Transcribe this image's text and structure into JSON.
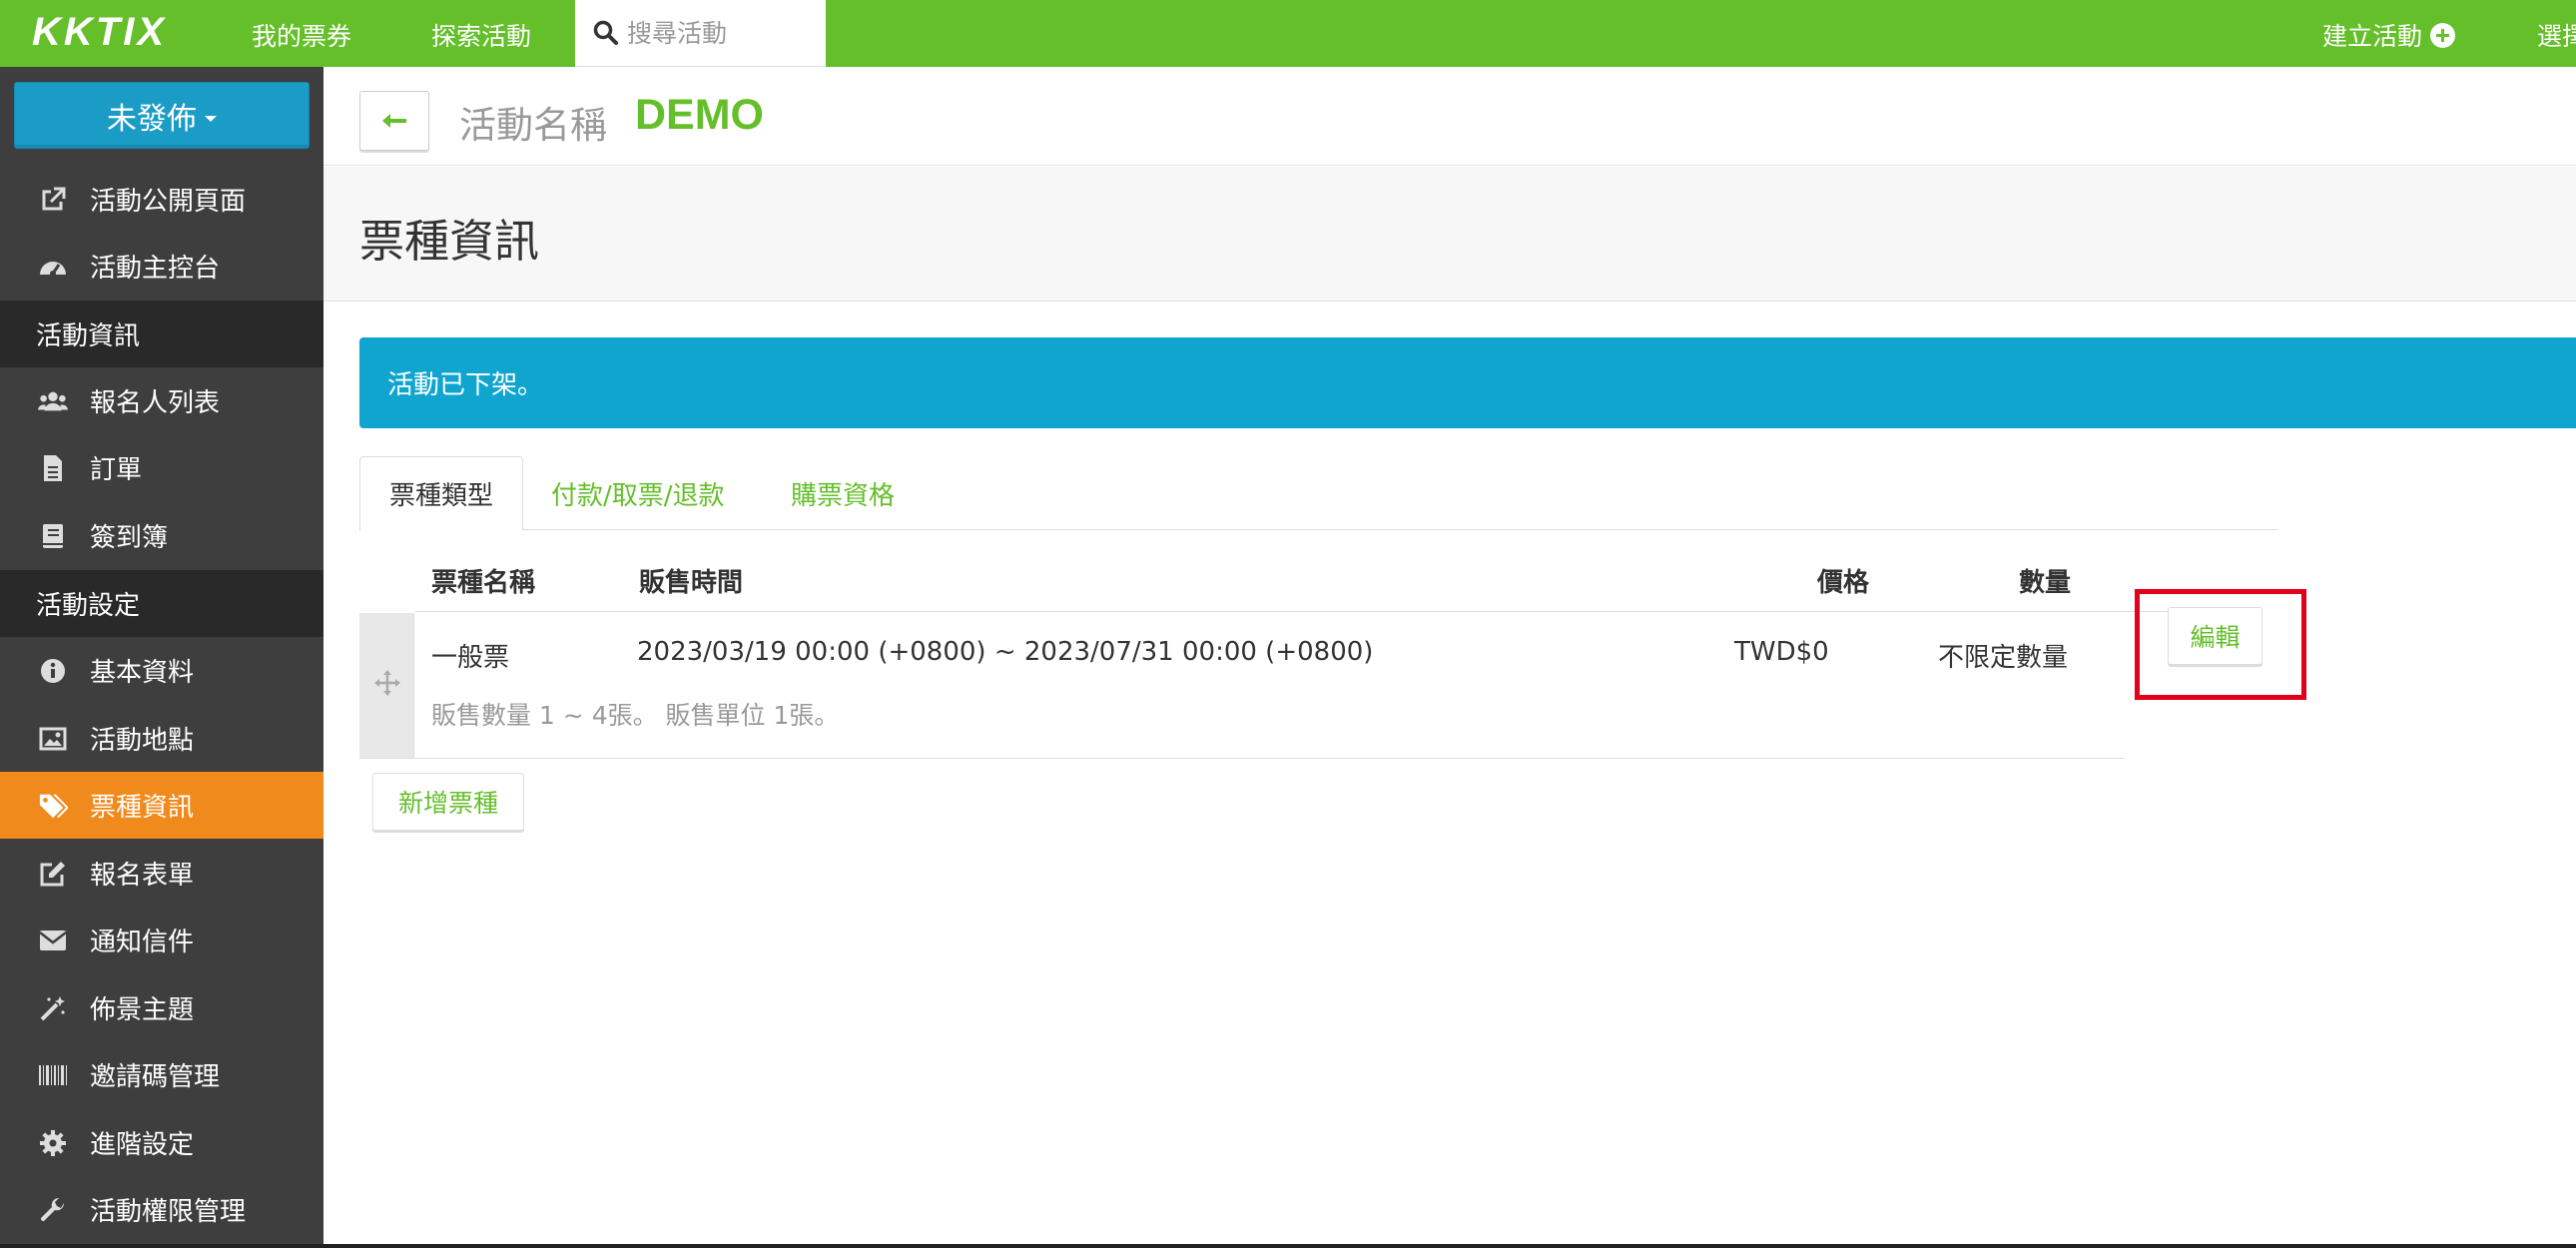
{
  "topbar": {
    "logo": "KKTIX",
    "nav": [
      {
        "label": "我的票券"
      },
      {
        "label": "探索活動"
      }
    ],
    "search_placeholder": "搜尋活動",
    "create_label": "建立活動",
    "lang_label": "選擇"
  },
  "sidebar": {
    "status_label": "未發佈",
    "items": [
      {
        "label": "活動公開頁面",
        "icon": "external-link-icon"
      },
      {
        "label": "活動主控台",
        "icon": "dashboard-icon"
      }
    ],
    "section_info": "活動資訊",
    "info_items": [
      {
        "label": "報名人列表",
        "icon": "users-icon"
      },
      {
        "label": "訂單",
        "icon": "file-icon"
      },
      {
        "label": "簽到簿",
        "icon": "book-icon"
      }
    ],
    "section_settings": "活動設定",
    "settings_items": [
      {
        "label": "基本資料",
        "icon": "info-icon"
      },
      {
        "label": "活動地點",
        "icon": "image-icon"
      },
      {
        "label": "票種資訊",
        "icon": "tags-icon",
        "active": true
      },
      {
        "label": "報名表單",
        "icon": "edit-icon"
      },
      {
        "label": "通知信件",
        "icon": "envelope-icon"
      },
      {
        "label": "佈景主題",
        "icon": "magic-icon"
      },
      {
        "label": "邀請碼管理",
        "icon": "barcode-icon"
      },
      {
        "label": "進階設定",
        "icon": "gear-icon"
      },
      {
        "label": "活動權限管理",
        "icon": "wrench-icon"
      }
    ]
  },
  "main": {
    "event_label": "活動名稱",
    "event_name": "DEMO",
    "page_title": "票種資訊",
    "alert": "活動已下架。",
    "tabs": [
      {
        "label": "票種類型",
        "active": true
      },
      {
        "label": "付款/取票/退款"
      },
      {
        "label": "購票資格"
      }
    ],
    "table": {
      "headers": {
        "name": "票種名稱",
        "time": "販售時間",
        "price": "價格",
        "qty": "數量"
      },
      "rows": [
        {
          "name": "一般票",
          "time": "2023/03/19 00:00 (+0800) ~ 2023/07/31 00:00 (+0800)",
          "price": "TWD$0",
          "qty": "不限定數量",
          "sub": "販售數量 1 ~ 4張。 販售單位 1張。",
          "edit_label": "編輯"
        }
      ]
    },
    "add_button": "新增票種"
  },
  "colors": {
    "brand_green": "#65bf2b",
    "active_orange": "#f08a1c",
    "alert_blue": "#0fa5cf",
    "highlight_red": "#e3001b"
  }
}
